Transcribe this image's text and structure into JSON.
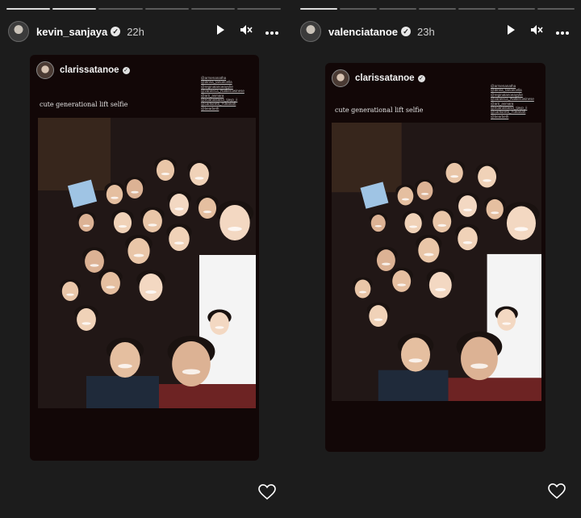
{
  "stories": [
    {
      "username": "kevin_sanjaya",
      "verified_mark": "✓",
      "time_ago": "22h",
      "progress_total": 6,
      "progress_done": 2,
      "icons": [
        "play-icon",
        "mute-icon",
        "more-icon"
      ],
      "shared_post": {
        "username": "clarissatanoe",
        "verified_mark": "✓",
        "caption": "cute generational lift selfie",
        "mentions": [
          "@arrsenanatha",
          "@dinna_tanoecella",
          "@reginatanoeayylie",
          "@vaneeca_Ralberowinese",
          "@arti_asmara",
          "@eoanastaisa_tjayp_ii",
          "@carlloretti_Ydeanah",
          "@bearbeth"
        ]
      },
      "like_icon": "heart-icon"
    },
    {
      "username": "valenciatanoe",
      "verified_mark": "✓",
      "time_ago": "23h",
      "progress_total": 7,
      "progress_done": 1,
      "icons": [
        "play-icon",
        "mute-icon",
        "more-icon"
      ],
      "shared_post": {
        "username": "clarissatanoe",
        "verified_mark": "✓",
        "caption": "cute generational lift selfie",
        "mentions": [
          "@arrsenanatha",
          "@dinna_tanoecella",
          "@reginatanoeayylie",
          "@vaneeca_Ralberowinese",
          "@arti_asmara",
          "@eoanastaisa_tjayp_ii",
          "@carlloretti_Ydeanah",
          "@bearbeth"
        ]
      },
      "like_icon": "heart-icon"
    }
  ],
  "colors": {
    "background": "#1c1c1c",
    "card": "#120707",
    "progress_done": "#dcdcdc",
    "progress_todo": "#5a5a5a"
  }
}
